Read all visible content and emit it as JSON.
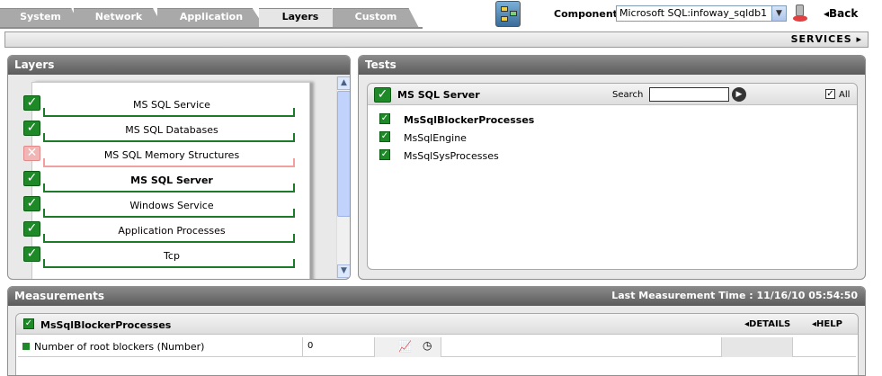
{
  "tabs": [
    {
      "label": "System",
      "active": false
    },
    {
      "label": "Network",
      "active": false
    },
    {
      "label": "Application",
      "active": false
    },
    {
      "label": "Layers",
      "active": true
    },
    {
      "label": "Custom",
      "active": false
    }
  ],
  "component": {
    "label": "Component",
    "value": "Microsoft SQL:infoway_sqldb1"
  },
  "back_label": "Back",
  "services_label": "SERVICES",
  "layers": {
    "title": "Layers",
    "items": [
      {
        "label": "MS SQL Service",
        "status": "ok",
        "bold": false
      },
      {
        "label": "MS SQL Databases",
        "status": "ok",
        "bold": false
      },
      {
        "label": "MS SQL Memory Structures",
        "status": "error",
        "bold": false
      },
      {
        "label": "MS SQL Server",
        "status": "ok",
        "bold": true
      },
      {
        "label": "Windows Service",
        "status": "ok",
        "bold": false
      },
      {
        "label": "Application Processes",
        "status": "ok",
        "bold": false
      },
      {
        "label": "Tcp",
        "status": "ok",
        "bold": false
      }
    ]
  },
  "tests": {
    "title": "Tests",
    "layer_name": "MS SQL Server",
    "search_label": "Search",
    "search_value": "",
    "all_label": "All",
    "items": [
      {
        "label": "MsSqlBlockerProcesses",
        "bold": true
      },
      {
        "label": "MsSqlEngine",
        "bold": false
      },
      {
        "label": "MsSqlSysProcesses",
        "bold": false
      }
    ]
  },
  "measurements": {
    "title": "Measurements",
    "last_time": "Last Measurement Time : 11/16/10 05:54:50",
    "test_name": "MsSqlBlockerProcesses",
    "details_label": "DETAILS",
    "help_label": "HELP",
    "rows": [
      {
        "name": "Number of root blockers (Number)",
        "value": "0"
      }
    ]
  },
  "colors": {
    "ok": "#1d8a27",
    "error": "#f2b5b5",
    "header": "#6b6b6b"
  }
}
